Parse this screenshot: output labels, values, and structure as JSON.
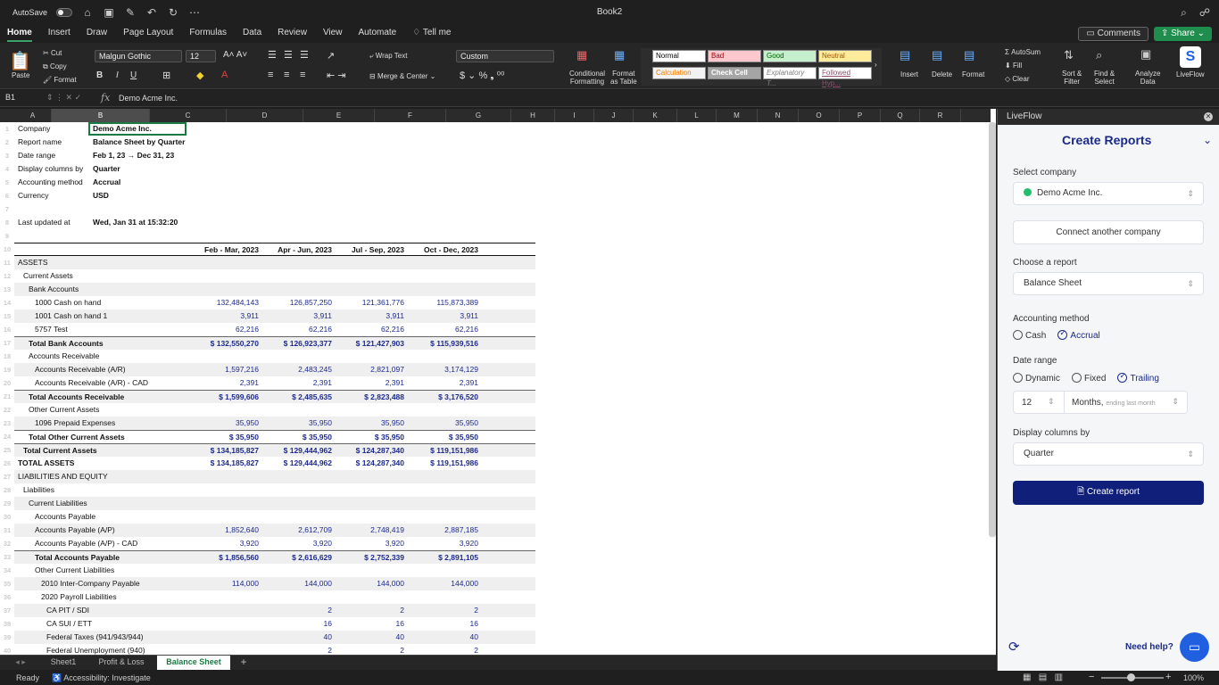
{
  "app": {
    "autosave_label": "AutoSave",
    "doc_title": "Book2"
  },
  "menu": {
    "tabs": [
      "Home",
      "Insert",
      "Draw",
      "Page Layout",
      "Formulas",
      "Data",
      "Review",
      "View",
      "Automate"
    ],
    "tell_me": "Tell me",
    "comments": "Comments",
    "share": "Share"
  },
  "ribbon": {
    "paste": "Paste",
    "cut": "Cut",
    "copy": "Copy",
    "format": "Format",
    "font_name": "Malgun Gothic",
    "font_size": "12",
    "wrap_text": "Wrap Text",
    "merge_center": "Merge & Center",
    "number_format": "Custom",
    "conditional_formatting": [
      "Conditional",
      "Formatting"
    ],
    "format_as_table": [
      "Format",
      "as Table"
    ],
    "styles": {
      "normal": "Normal",
      "bad": "Bad",
      "good": "Good",
      "neutral": "Neutral",
      "calculation": "Calculation",
      "check_cell": "Check Cell",
      "explanatory": "Explanatory T...",
      "followed": "Followed Hyp..."
    },
    "insert": "Insert",
    "delete": "Delete",
    "format_btn": "Format",
    "autosum": "AutoSum",
    "fill": "Fill",
    "clear": "Clear",
    "sort_filter": [
      "Sort &",
      "Filter"
    ],
    "find_select": [
      "Find &",
      "Select"
    ],
    "analyze": [
      "Analyze",
      "Data"
    ],
    "liveflow": "LiveFlow"
  },
  "formula_bar": {
    "cell": "B1",
    "fx": "fx",
    "value": "Demo Acme Inc."
  },
  "columns": [
    "A",
    "B",
    "C",
    "D",
    "E",
    "F",
    "G",
    "H",
    "I",
    "J",
    "K",
    "L",
    "M",
    "N",
    "O",
    "P",
    "Q",
    "R"
  ],
  "rows_numbers": [
    "1",
    "2",
    "3",
    "4",
    "5",
    "6",
    "7",
    "8",
    "9",
    "10",
    "11",
    "12",
    "13",
    "14",
    "15",
    "16",
    "17",
    "18",
    "19",
    "20",
    "21",
    "22",
    "23",
    "24",
    "25",
    "26",
    "27",
    "28",
    "29",
    "30",
    "31",
    "32",
    "33",
    "34",
    "35",
    "36",
    "37",
    "38",
    "39",
    "40"
  ],
  "meta": [
    {
      "label": "Company",
      "value": "Demo Acme Inc."
    },
    {
      "label": "Report name",
      "value": "Balance Sheet by Quarter"
    },
    {
      "label": "Date range",
      "value": "Feb 1, 23 → Dec 31, 23"
    },
    {
      "label": "Display columns by",
      "value": "Quarter"
    },
    {
      "label": "Accounting method",
      "value": "Accrual"
    },
    {
      "label": "Currency",
      "value": "USD"
    },
    {
      "label": "Last updated at",
      "value": "Wed, Jan 31 at 15:32:20"
    }
  ],
  "period_headers": [
    "Feb - Mar, 2023",
    "Apr - Jun, 2023",
    "Jul - Sep, 2023",
    "Oct - Dec, 2023"
  ],
  "report_rows": [
    {
      "label": "ASSETS",
      "vals": []
    },
    {
      "label": "Current Assets",
      "vals": []
    },
    {
      "label": "Bank Accounts",
      "vals": []
    },
    {
      "label": "1000 Cash on hand",
      "vals": [
        "132,484,143",
        "126,857,250",
        "121,361,776",
        "115,873,389"
      ]
    },
    {
      "label": "1001 Cash on hand 1",
      "vals": [
        "3,911",
        "3,911",
        "3,911",
        "3,911"
      ]
    },
    {
      "label": "5757 Test",
      "vals": [
        "62,216",
        "62,216",
        "62,216",
        "62,216"
      ]
    },
    {
      "label": "Total Bank Accounts",
      "vals": [
        "$ 132,550,270",
        "$ 126,923,377",
        "$ 121,427,903",
        "$ 115,939,516"
      ]
    },
    {
      "label": "Accounts Receivable",
      "vals": []
    },
    {
      "label": "Accounts Receivable (A/R)",
      "vals": [
        "1,597,216",
        "2,483,245",
        "2,821,097",
        "3,174,129"
      ]
    },
    {
      "label": "Accounts Receivable (A/R) - CAD",
      "vals": [
        "2,391",
        "2,391",
        "2,391",
        "2,391"
      ]
    },
    {
      "label": "Total Accounts Receivable",
      "vals": [
        "$ 1,599,606",
        "$ 2,485,635",
        "$ 2,823,488",
        "$ 3,176,520"
      ]
    },
    {
      "label": "Other Current Assets",
      "vals": []
    },
    {
      "label": "1096 Prepaid Expenses",
      "vals": [
        "35,950",
        "35,950",
        "35,950",
        "35,950"
      ]
    },
    {
      "label": "Total Other Current Assets",
      "vals": [
        "$ 35,950",
        "$ 35,950",
        "$ 35,950",
        "$ 35,950"
      ]
    },
    {
      "label": "Total Current Assets",
      "vals": [
        "$ 134,185,827",
        "$ 129,444,962",
        "$ 124,287,340",
        "$ 119,151,986"
      ]
    },
    {
      "label": "TOTAL ASSETS",
      "vals": [
        "$ 134,185,827",
        "$ 129,444,962",
        "$ 124,287,340",
        "$ 119,151,986"
      ]
    },
    {
      "label": "LIABILITIES AND EQUITY",
      "vals": []
    },
    {
      "label": "Liabilities",
      "vals": []
    },
    {
      "label": "Current Liabilities",
      "vals": []
    },
    {
      "label": "Accounts Payable",
      "vals": []
    },
    {
      "label": "Accounts Payable (A/P)",
      "vals": [
        "1,852,640",
        "2,612,709",
        "2,748,419",
        "2,887,185"
      ]
    },
    {
      "label": "Accounts Payable (A/P) - CAD",
      "vals": [
        "3,920",
        "3,920",
        "3,920",
        "3,920"
      ]
    },
    {
      "label": "Total Accounts Payable",
      "vals": [
        "$ 1,856,560",
        "$ 2,616,629",
        "$ 2,752,339",
        "$ 2,891,105"
      ]
    },
    {
      "label": "Other Current Liabilities",
      "vals": []
    },
    {
      "label": "2010 Inter-Company Payable",
      "vals": [
        "114,000",
        "144,000",
        "144,000",
        "144,000"
      ]
    },
    {
      "label": "2020 Payroll Liabilities",
      "vals": []
    },
    {
      "label": "CA PIT / SDI",
      "vals": [
        "",
        "2",
        "2",
        "2"
      ]
    },
    {
      "label": "CA SUI / ETT",
      "vals": [
        "",
        "16",
        "16",
        "16"
      ]
    },
    {
      "label": "Federal Taxes (941/943/944)",
      "vals": [
        "",
        "40",
        "40",
        "40"
      ]
    },
    {
      "label": "Federal Unemployment (940)",
      "vals": [
        "",
        "2",
        "2",
        "2"
      ]
    }
  ],
  "sheet_tabs": [
    "Sheet1",
    "Profit & Loss",
    "Balance Sheet"
  ],
  "status": {
    "ready": "Ready",
    "accessibility": "Accessibility: Investigate",
    "zoom": "100%"
  },
  "pane": {
    "title": "LiveFlow",
    "heading": "Create Reports",
    "select_company_label": "Select company",
    "company": "Demo Acme Inc.",
    "connect_btn": "Connect another company",
    "choose_report_label": "Choose a report",
    "report": "Balance Sheet",
    "accounting_label": "Accounting method",
    "accounting_options": [
      "Cash",
      "Accrual"
    ],
    "date_range_label": "Date range",
    "date_options": [
      "Dynamic",
      "Fixed",
      "Trailing"
    ],
    "trailing_count": "12",
    "trailing_unit": "Months,",
    "trailing_hint": "ending last month",
    "display_label": "Display columns by",
    "display_value": "Quarter",
    "create_btn": "Create report",
    "need_help": "Need help?",
    "colors": {
      "primary": "#0f1f7a",
      "green": "#1fbf6b"
    }
  }
}
